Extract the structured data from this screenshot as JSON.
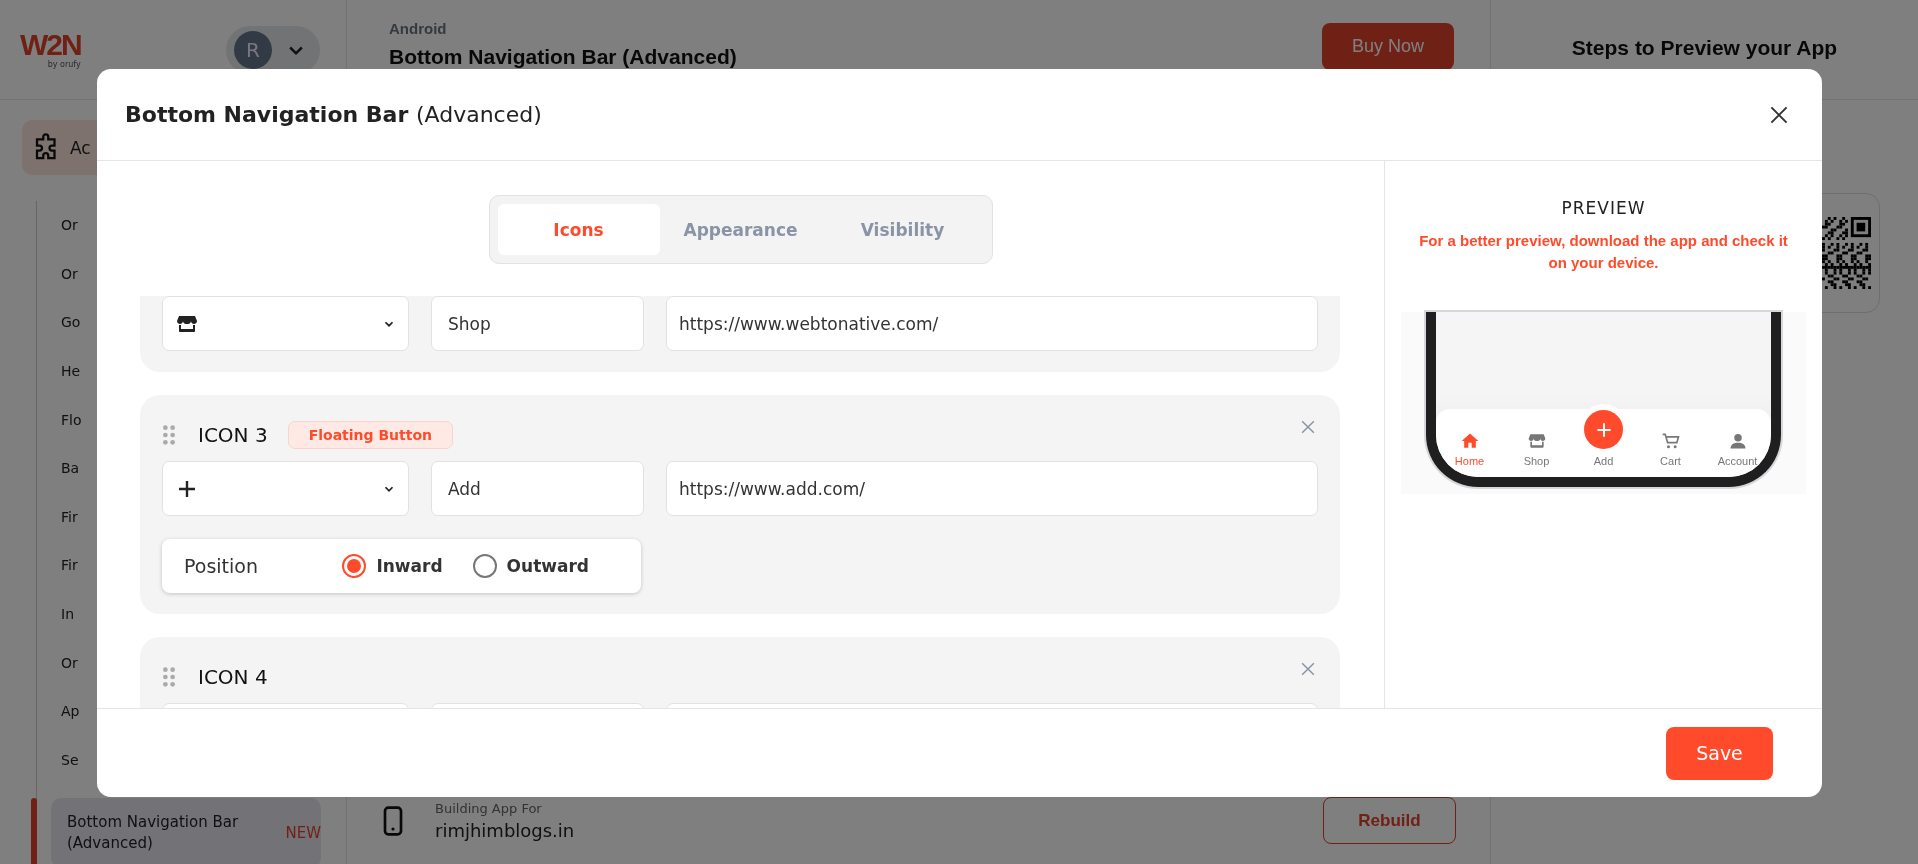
{
  "background_page": {
    "logo": {
      "mark": "W2N",
      "byline": "by orufy"
    },
    "avatar": {
      "initial": "R"
    },
    "header": {
      "platform": "Android",
      "title": "Bottom Navigation Bar (Advanced)",
      "buy_button": "Buy Now"
    },
    "right_panel": {
      "title": "Steps to Preview your App"
    },
    "sidebar": {
      "group": {
        "label": "Ac"
      },
      "items": [
        {
          "label": "Or",
          "selected": false
        },
        {
          "label": "Or",
          "selected": false
        },
        {
          "label": "Go",
          "selected": false
        },
        {
          "label": "He",
          "selected": false
        },
        {
          "label": "Flo",
          "selected": false
        },
        {
          "label": "Ba",
          "selected": false
        },
        {
          "label": "Fir",
          "selected": false
        },
        {
          "label": "Fir",
          "selected": false
        },
        {
          "label": "In",
          "selected": false
        },
        {
          "label": "Or",
          "selected": false
        },
        {
          "label": "Ap",
          "selected": false
        },
        {
          "label": "Se",
          "selected": false
        },
        {
          "label": "Bottom Navigation Bar (Advanced)",
          "badge": "NEW",
          "selected": true
        }
      ]
    },
    "build_info": {
      "caption": "Building App For",
      "domain": "rimjhimblogs.in",
      "rebuild_button": "Rebuild"
    }
  },
  "modal": {
    "title": "Bottom Navigation Bar",
    "title_suffix": "(Advanced)",
    "tabs": [
      {
        "label": "Icons",
        "selected": true
      },
      {
        "label": "Appearance",
        "selected": false
      },
      {
        "label": "Visibility",
        "selected": false
      }
    ],
    "icons": [
      {
        "kind": "store",
        "label": "Shop",
        "url": "https://www.webtonative.com/"
      },
      {
        "kind": "plus",
        "title": "ICON 3",
        "badge": "Floating Button",
        "label": "Add",
        "url": "https://www.add.com/",
        "position": {
          "label": "Position",
          "options": [
            {
              "label": "Inward",
              "selected": true
            },
            {
              "label": "Outward",
              "selected": false
            }
          ]
        }
      },
      {
        "kind": "blank",
        "title": "ICON 4"
      }
    ],
    "preview": {
      "title": "PREVIEW",
      "note": "For a better preview, download the app and check it on your device.",
      "nav_items": [
        {
          "kind": "home",
          "label": "Home",
          "selected": true
        },
        {
          "kind": "store",
          "label": "Shop",
          "selected": false
        },
        {
          "kind": "floating",
          "label": "Add",
          "selected": false
        },
        {
          "kind": "cart",
          "label": "Cart",
          "selected": false
        },
        {
          "kind": "person",
          "label": "Account",
          "selected": false
        }
      ]
    },
    "save_button": "Save"
  }
}
